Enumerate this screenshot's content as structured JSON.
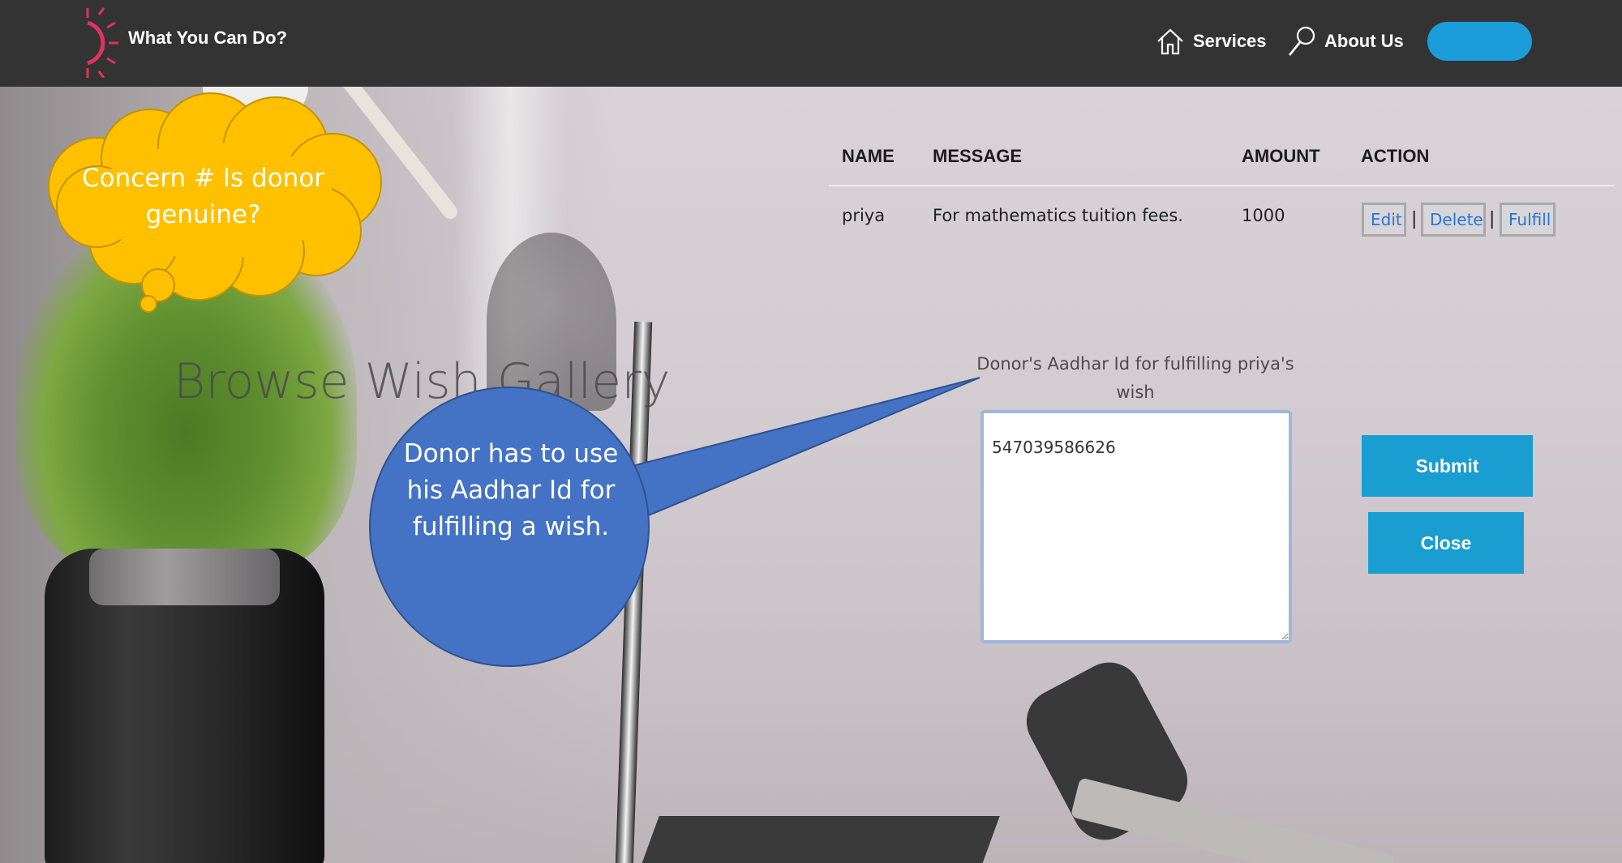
{
  "navbar": {
    "brand": "What You Can Do?",
    "services_label": "Services",
    "about_label": "About Us",
    "accent_color": "#1a9dd9",
    "logo_color": "#e0325e"
  },
  "table": {
    "headers": [
      "NAME",
      "MESSAGE",
      "AMOUNT",
      "ACTION"
    ],
    "row": {
      "name": "priya",
      "message": "For mathematics tuition fees.",
      "amount": "1000"
    },
    "actions": [
      "Edit",
      "Delete",
      "Fulfill"
    ],
    "separator": "|"
  },
  "gallery_title": "Browse Wish Gallery",
  "form": {
    "label": "Donor's Aadhar Id for fulfilling priya's wish",
    "aadhar_value": "547039586626",
    "submit_label": "Submit",
    "close_label": "Close"
  },
  "callouts": {
    "cloud": "Concern # Is donor genuine?",
    "bubble": "Donor has to use his Aadhar Id for fulfilling a wish.",
    "cloud_color": "#ffc000",
    "bubble_color": "#4472c4"
  }
}
